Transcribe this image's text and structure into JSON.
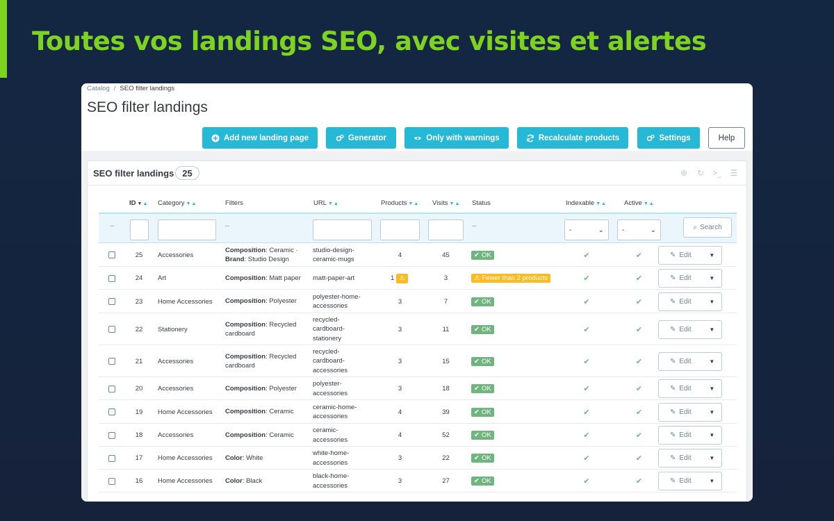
{
  "headline": "Toutes vos landings SEO, avec visites et alertes",
  "colors": {
    "accent": "#7ed321",
    "primary": "#25b9d7",
    "ok": "#70b580",
    "warning": "#fbbb22",
    "background": "#142640"
  },
  "breadcrumb": [
    "Catalog",
    "/",
    "SEO filter landings"
  ],
  "page_title": "SEO filter landings",
  "toolbar": {
    "add": "Add new landing page",
    "generator": "Generator",
    "warnings": "Only with warnings",
    "recalculate": "Recalculate products",
    "settings": "Settings",
    "help": "Help"
  },
  "panel": {
    "title": "SEO filter landings",
    "count": "25"
  },
  "columns": {
    "id": "ID",
    "category": "Category",
    "filters": "Filters",
    "url": "URL",
    "products": "Products",
    "visits": "Visits",
    "status": "Status",
    "indexable": "Indexable",
    "active": "Active"
  },
  "filter_row": {
    "dash": "--",
    "select_placeholder": "-",
    "search": "Search"
  },
  "edit_label": "Edit",
  "rows": [
    {
      "id": "25",
      "category": "Accessories",
      "filters": [
        [
          "Composition",
          "Ceramic ·"
        ],
        [
          "Brand",
          "Studio Design"
        ]
      ],
      "url": [
        "studio-design-",
        "ceramic-mugs"
      ],
      "products": "4",
      "visits": "45",
      "status": "OK",
      "warn": false
    },
    {
      "id": "24",
      "category": "Art",
      "filters": [
        [
          "Composition",
          "Matt paper"
        ]
      ],
      "url": [
        "matt-paper-art"
      ],
      "products": "1",
      "visits": "3",
      "status": "Fewer than 2 products",
      "warn": true
    },
    {
      "id": "23",
      "category": "Home Accessories",
      "filters": [
        [
          "Composition",
          "Polyester"
        ]
      ],
      "url": [
        "polyester-home-",
        "accessories"
      ],
      "products": "3",
      "visits": "7",
      "status": "OK",
      "warn": false
    },
    {
      "id": "22",
      "category": "Stationery",
      "filters": [
        [
          "Composition",
          "Recycled"
        ],
        [
          "",
          "cardboard"
        ]
      ],
      "url": [
        "recycled-",
        "cardboard-",
        "stationery"
      ],
      "products": "3",
      "visits": "11",
      "status": "OK",
      "warn": false
    },
    {
      "id": "21",
      "category": "Accessories",
      "filters": [
        [
          "Composition",
          "Recycled"
        ],
        [
          "",
          "cardboard"
        ]
      ],
      "url": [
        "recycled-",
        "cardboard-",
        "accessories"
      ],
      "products": "3",
      "visits": "15",
      "status": "OK",
      "warn": false
    },
    {
      "id": "20",
      "category": "Accessories",
      "filters": [
        [
          "Composition",
          "Polyester"
        ]
      ],
      "url": [
        "polyester-",
        "accessories"
      ],
      "products": "3",
      "visits": "18",
      "status": "OK",
      "warn": false
    },
    {
      "id": "19",
      "category": "Home Accessories",
      "filters": [
        [
          "Composition",
          "Ceramic"
        ]
      ],
      "url": [
        "ceramic-home-",
        "accessories"
      ],
      "products": "4",
      "visits": "39",
      "status": "OK",
      "warn": false
    },
    {
      "id": "18",
      "category": "Accessories",
      "filters": [
        [
          "Composition",
          "Ceramic"
        ]
      ],
      "url": [
        "ceramic-",
        "accessories"
      ],
      "products": "4",
      "visits": "52",
      "status": "OK",
      "warn": false
    },
    {
      "id": "17",
      "category": "Home Accessories",
      "filters": [
        [
          "Color",
          "White"
        ]
      ],
      "url": [
        "white-home-",
        "accessories"
      ],
      "products": "3",
      "visits": "22",
      "status": "OK",
      "warn": false
    },
    {
      "id": "16",
      "category": "Home Accessories",
      "filters": [
        [
          "Color",
          "Black"
        ]
      ],
      "url": [
        "black-home-",
        "accessories"
      ],
      "products": "3",
      "visits": "27",
      "status": "OK",
      "warn": false
    }
  ]
}
